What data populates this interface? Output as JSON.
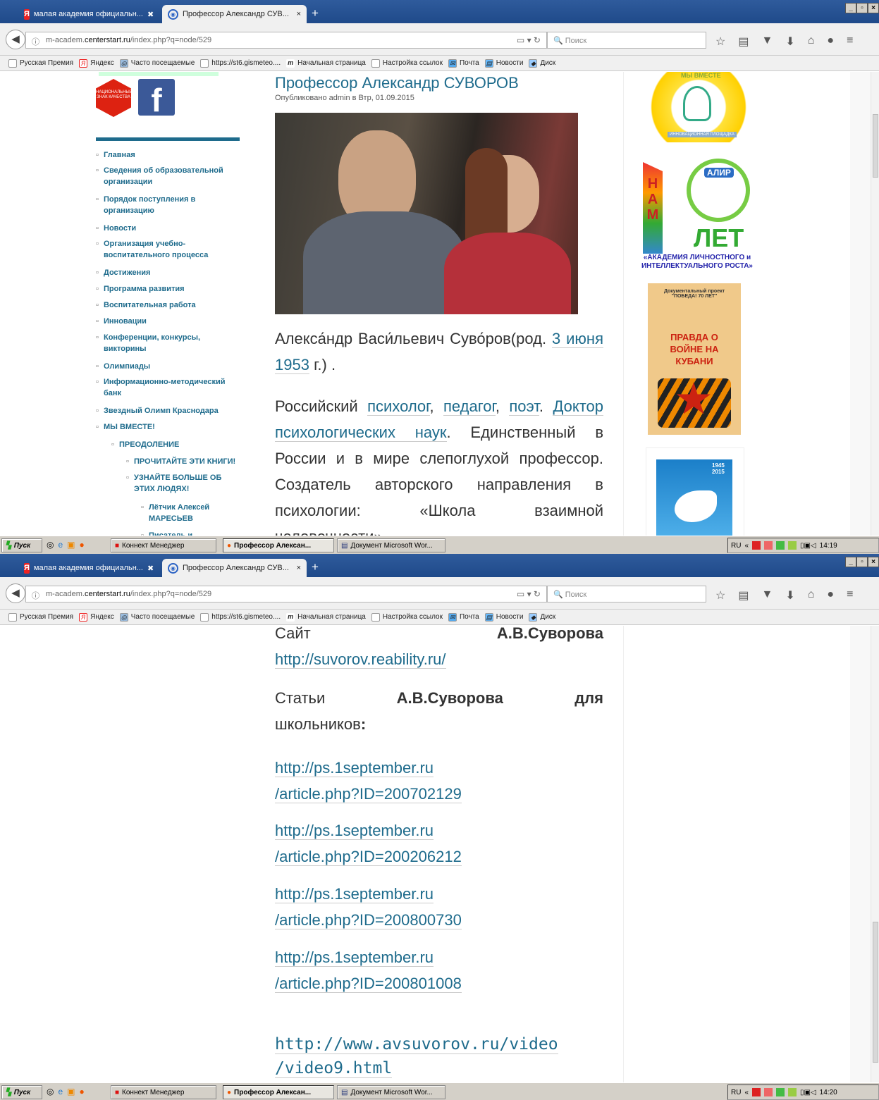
{
  "browser": {
    "tabs": [
      {
        "label": "малая академия официальн...",
        "close": "✖"
      },
      {
        "label": "Профессор Александр СУВ...",
        "close": "×"
      }
    ],
    "new_tab": "+",
    "url_domain": "m-academ.centerstart.ru",
    "url_path": "/index.php?q=node/529",
    "url_prefix": "m-academ.",
    "search_placeholder": "Поиск",
    "bookmarks": [
      "Русская Премия",
      "Яндекс",
      "Часто посещаемые",
      "https://st6.gismeteo....",
      "Начальная страница",
      "Настройка ссылок",
      "Почта",
      "Новости",
      "Диск"
    ]
  },
  "sidebar": {
    "badge_text": "НАЦИОНАЛЬНЫЙ ЗНАК КАЧЕСТВА",
    "facebook": "f",
    "menu": [
      "Главная",
      "Сведения об образовательной организации",
      "Порядок поступления в организацию",
      "Новости",
      "Организация учебно-воспитательного процесса",
      "Достижения",
      "Программа развития",
      "Воспитательная работа",
      "Инновации",
      "Конференции, конкурсы, викторины",
      "Олимпиады",
      "Информационно-методический банк",
      "Звездный Олимп Краснодара",
      "МЫ ВМЕСТЕ!",
      "ПРЕОДОЛЕНИЕ",
      "ПРОЧИТАЙТЕ ЭТИ КНИГИ!",
      "УЗНАЙТЕ БОЛЬШЕ ОБ ЭТИХ ЛЮДЯХ!",
      "Лётчик Алексей МАРЕСЬЕВ",
      "Писатель и"
    ]
  },
  "article": {
    "title": "Профессор Александр СУВОРОВ",
    "posted": "Опубликовано admin в Втр, 01.09.2015",
    "p1_text": "Алекса́ндр Васи́льевич Суво́ров(род.",
    "p1_link1": "3 июня",
    "p1_link2": "1953",
    "p1_tail": "г.) .",
    "p2_pre": "Российский",
    "p2_l1": "психолог",
    "p2_l2": "педагог",
    "p2_l3": "поэт",
    "p2_l4": "Доктор психологических наук",
    "p2_rest": "Единственный в России и в мире слепоглухой профессор. Создатель авторского направления в психологии: «Школа взаимной человечности».",
    "site_label": "Сайт",
    "site_name": "А.В.Суворова",
    "site_url": "http://suvorov.reability.ru/",
    "articles_label": "Статьи",
    "articles_name": "А.В.Суворова",
    "articles_for": "для",
    "articles_tail": "школьников",
    "links": [
      {
        "a": "http://ps.1september.ru",
        "b": "/article.php?ID=200702129"
      },
      {
        "a": "http://ps.1september.ru",
        "b": "/article.php?ID=200206212"
      },
      {
        "a": "http://ps.1september.ru",
        "b": "/article.php?ID=200800730"
      },
      {
        "a": "http://ps.1september.ru",
        "b": "/article.php?ID=200801008"
      }
    ],
    "video_a": "http://www.avsuvorov.ru/video",
    "video_b": "/video9.html"
  },
  "right": {
    "banner1": "ИННОВАЦИОННАЯ ПЛОЩАДКА",
    "banner1_top": "МЫ ВМЕСТЕ",
    "alir": "АЛИР",
    "nam": "НАМ",
    "let": "ЛЕТ",
    "academy": "«АКАДЕМИЯ ЛИЧНОСТНОГО и ИНТЕЛЛЕКТУАЛЬНОГО РОСТА»",
    "poster_top": "Документальный проект \"ПОБЕДА! 70 ЛЕТ\"",
    "poster_main": "ПРАВДА О ВОЙНЕ НА КУБАНИ",
    "dove_years": "1945 2015"
  },
  "taskbar": {
    "start": "Пуск",
    "items": [
      "Коннект Менеджер",
      "Профессор Алексан...",
      "Документ Microsoft Wor..."
    ],
    "lang": "RU",
    "time1": "14:19",
    "time2": "14:20"
  }
}
